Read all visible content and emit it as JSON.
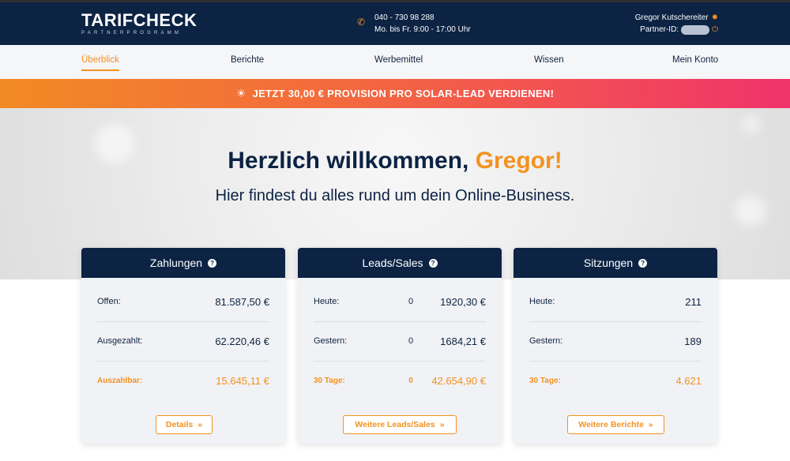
{
  "header": {
    "logo": {
      "main": "TARIFCHECK",
      "sub": "PARTNERPROGRAMM"
    },
    "phone": "040 - 730 98 288",
    "hours": "Mo. bis Fr. 9:00 - 17:00 Uhr",
    "user_name": "Gregor Kutschereiter",
    "partner_id_label": "Partner-ID:"
  },
  "nav": {
    "items": [
      "Überblick",
      "Berichte",
      "Werbemittel",
      "Wissen",
      "Mein Konto"
    ],
    "active": "Überblick"
  },
  "promo": {
    "text": "JETZT 30,00 € PROVISION PRO SOLAR-LEAD VERDIENEN!"
  },
  "hero": {
    "greeting": "Herzlich willkommen,",
    "name": "Gregor!",
    "subtitle": "Hier findest du alles rund um dein Online-Business."
  },
  "cards": [
    {
      "title": "Zahlungen",
      "rows": [
        {
          "label": "Offen:",
          "value": "81.587,50 €"
        },
        {
          "label": "Ausgezahlt:",
          "value": "62.220,46 €"
        },
        {
          "label": "Auszahlbar:",
          "value": "15.645,11 €"
        }
      ],
      "button": "Details"
    },
    {
      "title": "Leads/Sales",
      "rows": [
        {
          "label": "Heute:",
          "count": "0",
          "value": "1920,30 €"
        },
        {
          "label": "Gestern:",
          "count": "0",
          "value": "1684,21 €"
        },
        {
          "label": "30 Tage:",
          "count": "0",
          "value": "42.654,90 €"
        }
      ],
      "button": "Weitere Leads/Sales"
    },
    {
      "title": "Sitzungen",
      "rows": [
        {
          "label": "Heute:",
          "value": "211"
        },
        {
          "label": "Gestern:",
          "value": "189"
        },
        {
          "label": "30 Tage:",
          "value": "4.621"
        }
      ],
      "button": "Weitere Berichte"
    }
  ],
  "colors": {
    "navy": "#0c2344",
    "accent": "#f39221",
    "promo_start": "#f28a24",
    "promo_end": "#f0336b"
  },
  "icons": {
    "phone": "phone-icon",
    "settings": "gear-icon",
    "logout": "power-icon",
    "help": "help-icon",
    "promo": "sun-icon"
  }
}
